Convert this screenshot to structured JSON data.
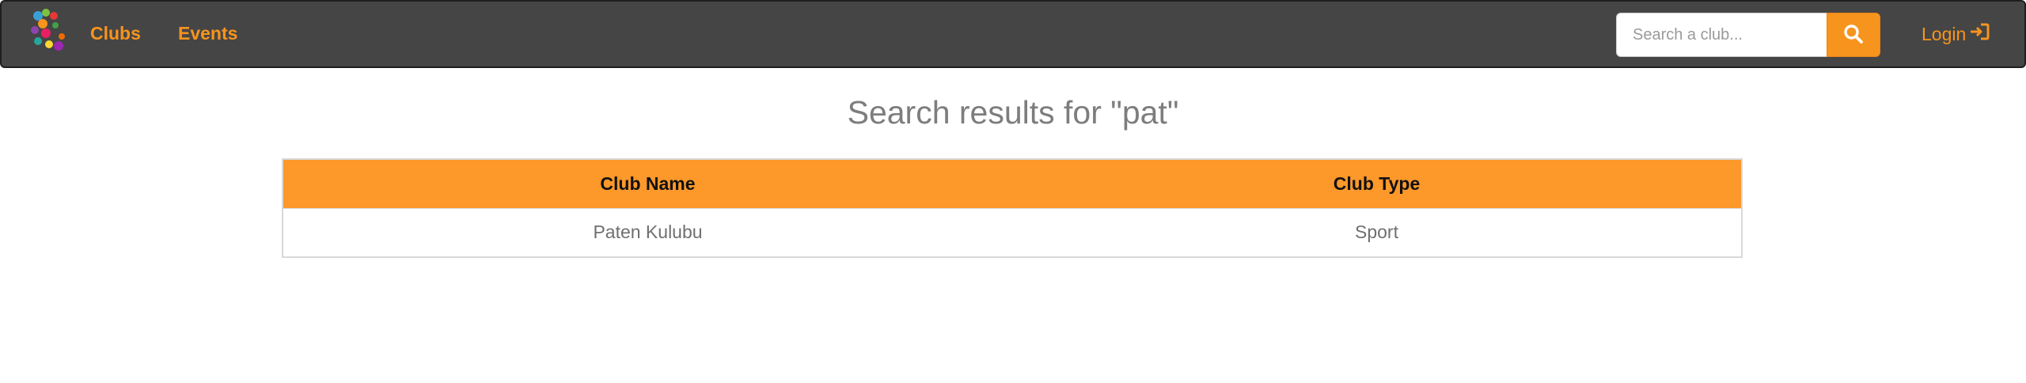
{
  "nav": {
    "clubs_label": "Clubs",
    "events_label": "Events",
    "login_label": "Login",
    "accent_color": "#f7941d",
    "background_color": "#454545"
  },
  "search": {
    "placeholder": "Search a club...",
    "value": ""
  },
  "main": {
    "title": "Search results for \"pat\""
  },
  "table": {
    "headers": [
      "Club Name",
      "Club Type"
    ],
    "header_color": "#fd982a",
    "rows": [
      [
        "Paten Kulubu",
        "Sport"
      ]
    ]
  },
  "icons": {
    "brand": "colorful-club-logo-icon",
    "search": "search-icon",
    "login": "sign-in-icon"
  }
}
